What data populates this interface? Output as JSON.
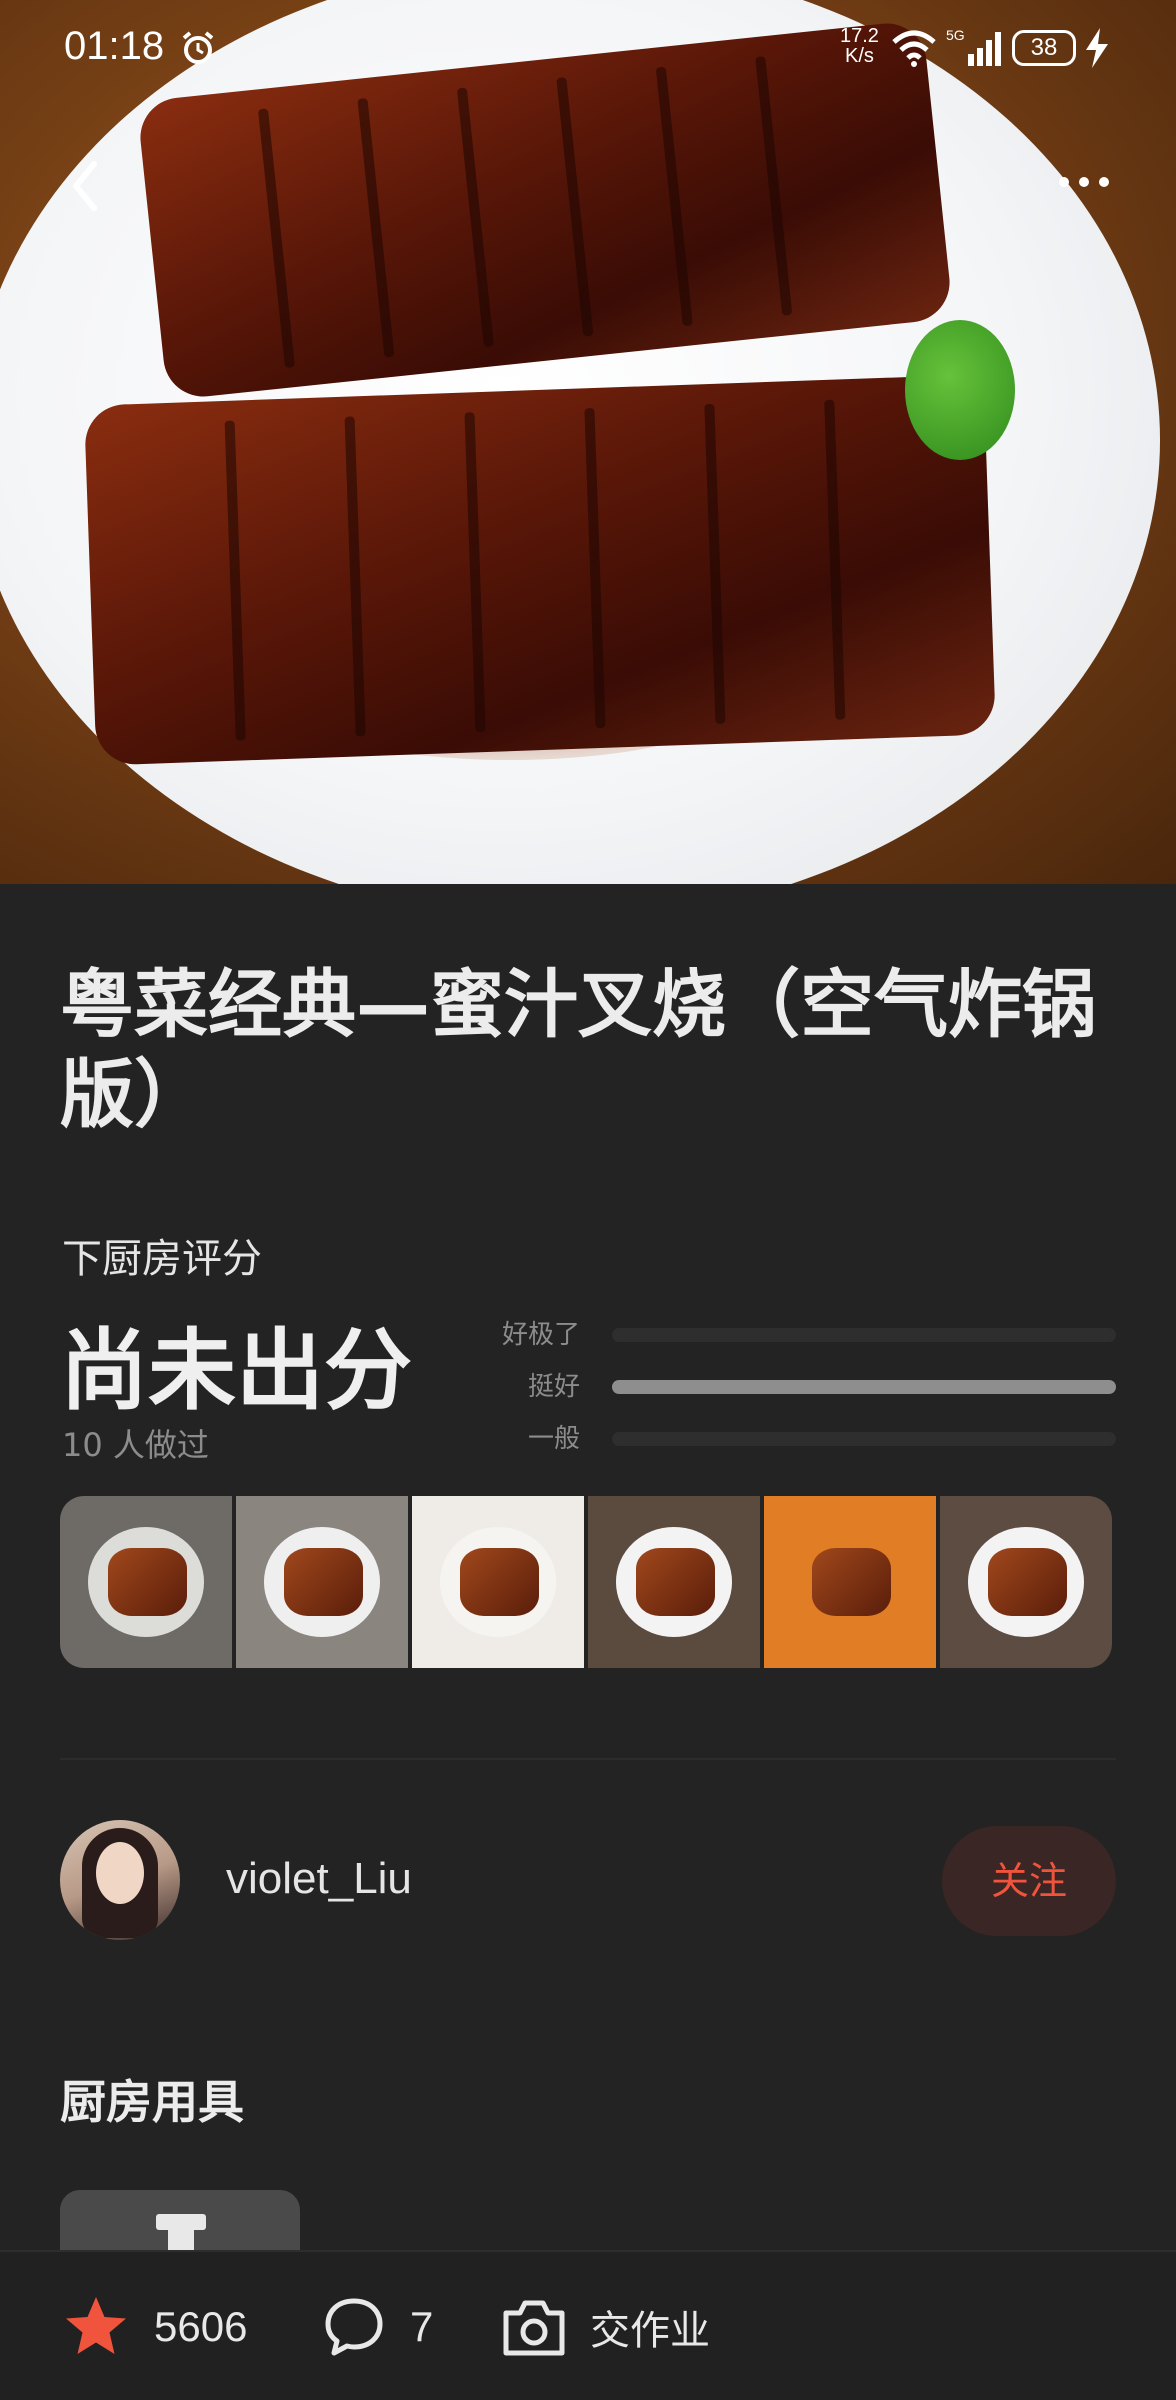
{
  "status_bar": {
    "time": "01:18",
    "speed_value": "17.2",
    "speed_unit": "K/s",
    "network": "5G",
    "battery": "38"
  },
  "recipe": {
    "title": "粤菜经典—蜜汁叉烧（空气炸锅版）"
  },
  "rating": {
    "label": "下厨房评分",
    "value": "尚未出分",
    "made_count": "10 人做过",
    "levels": [
      {
        "label": "好极了",
        "fill": 0.0
      },
      {
        "label": "挺好",
        "fill": 1.0
      },
      {
        "label": "一般",
        "fill": 0.0
      }
    ]
  },
  "gallery": {
    "thumbs": [
      {
        "name": "thumb-1",
        "bg": "#6e6a66",
        "dish": "#dcdcd8"
      },
      {
        "name": "thumb-2",
        "bg": "#8a857f",
        "dish": "#efefef"
      },
      {
        "name": "thumb-3",
        "bg": "#efece8",
        "dish": "#f6f4f0"
      },
      {
        "name": "thumb-4",
        "bg": "#5b4a3e",
        "dish": "#f3f3f3"
      },
      {
        "name": "thumb-5",
        "bg": "#e07d25",
        "dish": "#e07d25"
      },
      {
        "name": "thumb-6",
        "bg": "#5c4c42",
        "dish": "#f3f3f3"
      }
    ]
  },
  "author": {
    "username": "violet_Liu",
    "follow_label": "关注"
  },
  "tools": {
    "title": "厨房用具"
  },
  "bottom_bar": {
    "likes": "5606",
    "comments": "7",
    "homework_label": "交作业"
  },
  "colors": {
    "accent": "#f0543c",
    "background": "#232323"
  }
}
